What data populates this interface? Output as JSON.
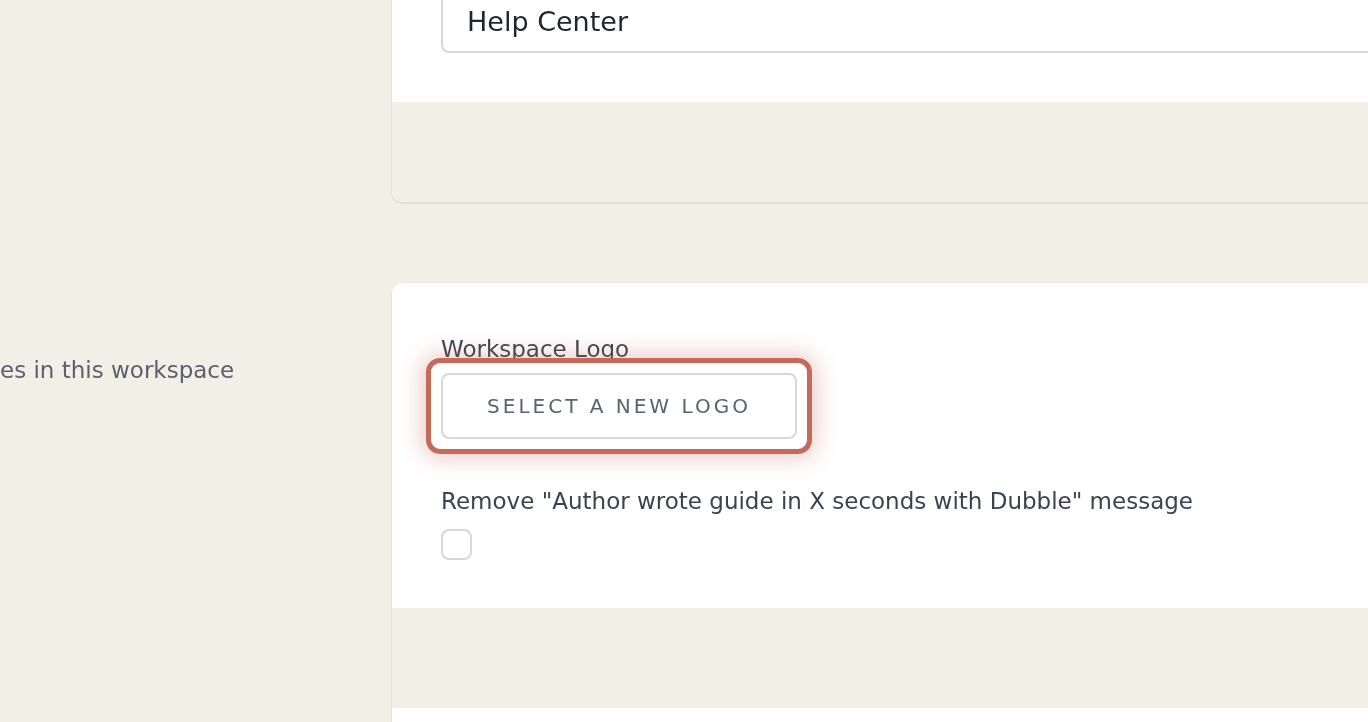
{
  "sidebar": {
    "description": "es in this workspace"
  },
  "top_card": {
    "field": {
      "value": "Help Center"
    }
  },
  "logo_card": {
    "logo_label": "Workspace Logo",
    "select_button": {
      "label": "SELECT A NEW LOGO",
      "highlighted": true
    },
    "remove_message": {
      "label": "Remove \"Author wrote guide in X seconds with Dubble\" message",
      "checked": false
    }
  }
}
